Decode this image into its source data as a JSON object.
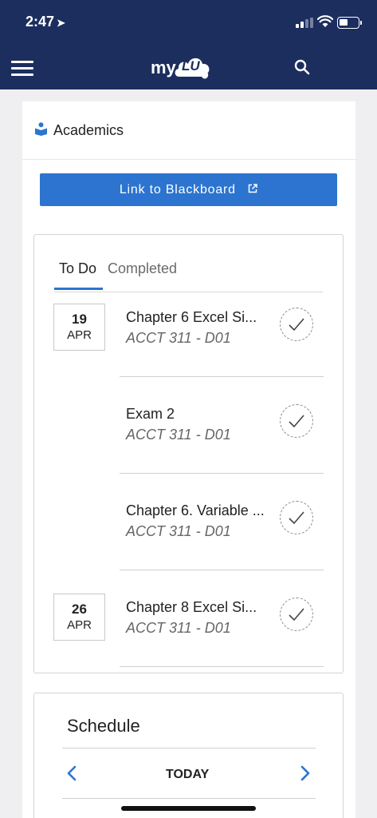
{
  "status_bar": {
    "time": "2:47",
    "location_arrow": "➤"
  },
  "app_bar": {
    "logo_my": "my",
    "logo_lu": "LU",
    "menu_icon": "hamburger-menu-icon",
    "search_icon": "search-icon"
  },
  "academics": {
    "title": "Academics",
    "icon": "book-reader-icon",
    "blackboard_button": "Link to Blackboard",
    "tabs": [
      {
        "label": "To Do",
        "active": true
      },
      {
        "label": "Completed",
        "active": false
      }
    ],
    "tasks": [
      {
        "day": "19",
        "month": "APR",
        "title": "Chapter 6 Excel Si...",
        "course": "ACCT 311 - D01"
      },
      {
        "day": "",
        "month": "",
        "title": "Exam 2",
        "course": "ACCT 311 - D01"
      },
      {
        "day": "",
        "month": "",
        "title": "Chapter 6. Variable ...",
        "course": "ACCT 311 - D01"
      },
      {
        "day": "26",
        "month": "APR",
        "title": "Chapter 8 Excel Si...",
        "course": "ACCT 311 - D01"
      }
    ]
  },
  "schedule": {
    "title": "Schedule",
    "today_label": "TODAY"
  },
  "colors": {
    "header": "#1c2e5e",
    "accent": "#2c74cf",
    "background": "#efeff1"
  }
}
